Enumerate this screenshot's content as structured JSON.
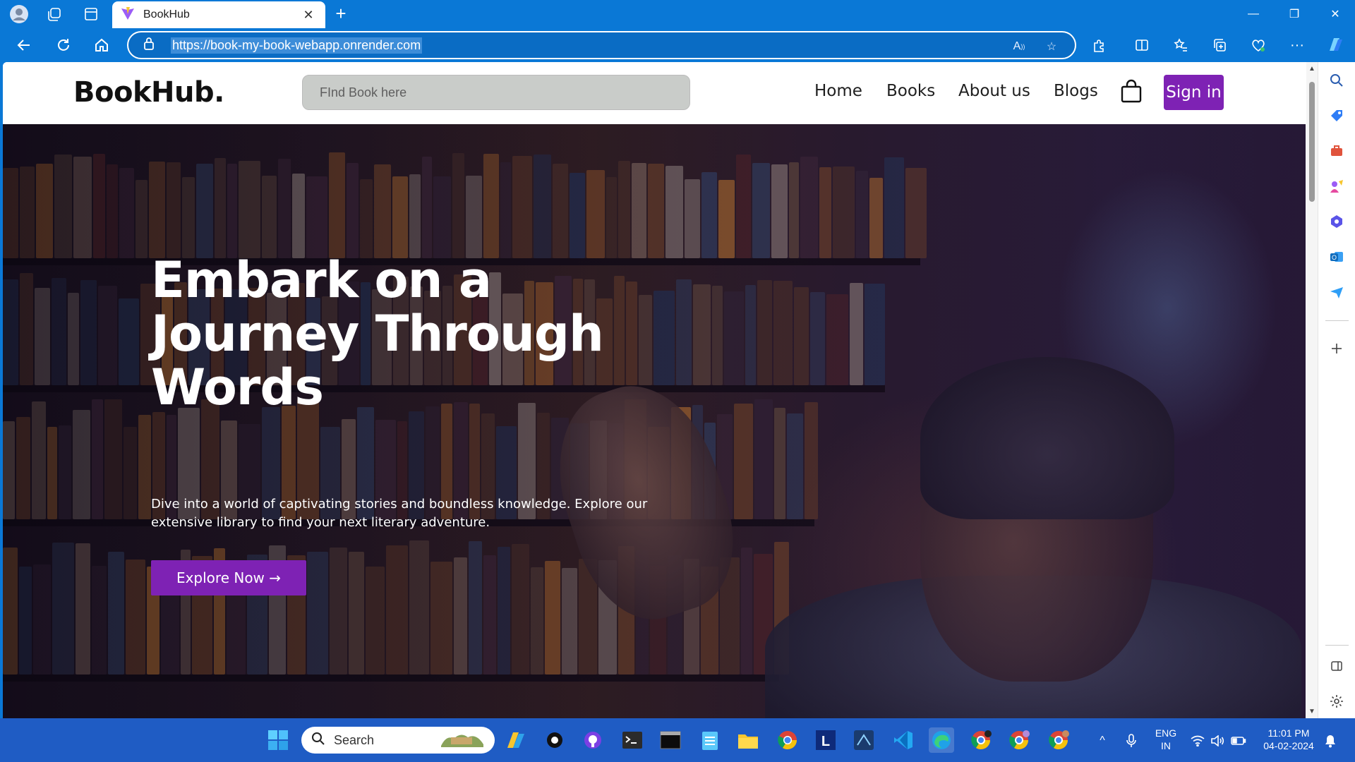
{
  "browser": {
    "tab_title": "BookHub",
    "tab_close": "✕",
    "new_tab": "+",
    "url": "https://book-my-book-webapp.onrender.com",
    "window_controls": {
      "minimize": "—",
      "restore": "❐",
      "close": "✕"
    },
    "accent_color": "#0a78d6"
  },
  "site": {
    "logo": "BookHub.",
    "search_placeholder": "FInd Book here",
    "nav": [
      "Home",
      "Books",
      "About us",
      "Blogs"
    ],
    "signin_label": "Sign in",
    "brand_color": "#7e22b4"
  },
  "hero": {
    "title": "Embark on a Journey Through Words",
    "text": "Dive into a world of captivating stories and boundless knowledge. Explore our extensive library to find your next literary adventure.",
    "button_label": "Explore Now →"
  },
  "taskbar": {
    "search_label": "Search",
    "lang_top": "ENG",
    "lang_bottom": "IN",
    "time": "11:01 PM",
    "date": "04-02-2024"
  }
}
